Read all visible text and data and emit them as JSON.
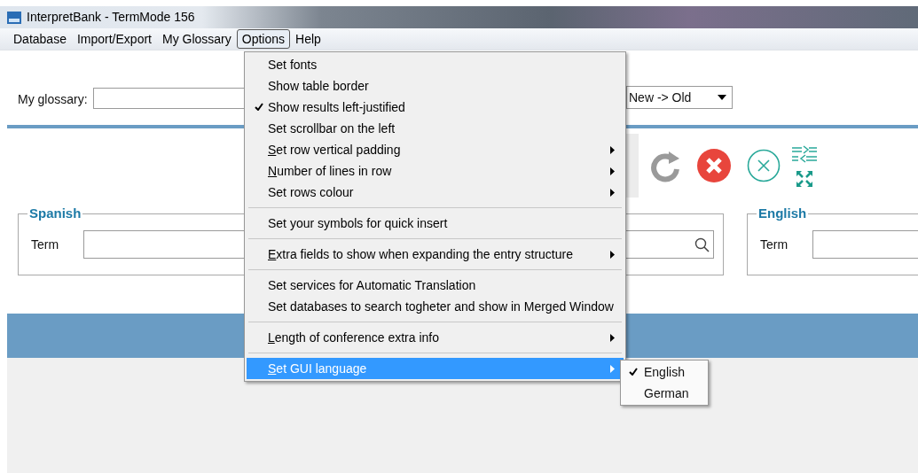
{
  "window": {
    "title": "InterpretBank - TermMode 156"
  },
  "menu_bar": [
    {
      "label": "Database",
      "selected": false
    },
    {
      "label": "Import/Export",
      "selected": false
    },
    {
      "label": "My Glossary",
      "selected": false
    },
    {
      "label": "Options",
      "selected": true
    },
    {
      "label": "Help",
      "selected": false
    }
  ],
  "glossary": {
    "label": "My glossary:",
    "sort": "New -> Old"
  },
  "language_panels": [
    {
      "language": "Spanish",
      "term_label": "Term"
    },
    {
      "language": "English",
      "term_label": "Term"
    }
  ],
  "options_menu": [
    [
      {
        "label": "Set fonts",
        "checked": false,
        "submenu": false,
        "mnemonic": false,
        "highlighted": false
      },
      {
        "label": "Show table border",
        "checked": false,
        "submenu": false,
        "mnemonic": false,
        "highlighted": false
      },
      {
        "label": "Show results left-justified",
        "checked": true,
        "submenu": false,
        "mnemonic": false,
        "highlighted": false
      },
      {
        "label": "Set scrollbar on the left",
        "checked": false,
        "submenu": false,
        "mnemonic": false,
        "highlighted": false
      },
      {
        "label": "Set row vertical padding",
        "checked": false,
        "submenu": true,
        "mnemonic": true,
        "highlighted": false
      },
      {
        "label": "Number of lines in row",
        "checked": false,
        "submenu": true,
        "mnemonic": true,
        "highlighted": false
      },
      {
        "label": "Set rows colour",
        "checked": false,
        "submenu": true,
        "mnemonic": false,
        "highlighted": false
      }
    ],
    [
      {
        "label": "Set your symbols for quick insert",
        "checked": false,
        "submenu": false,
        "mnemonic": false,
        "highlighted": false
      }
    ],
    [
      {
        "label": "Extra fields to show when expanding the entry structure",
        "checked": false,
        "submenu": true,
        "mnemonic": true,
        "highlighted": false
      }
    ],
    [
      {
        "label": "Set services for Automatic Translation",
        "checked": false,
        "submenu": false,
        "mnemonic": false,
        "highlighted": false
      },
      {
        "label": "Set databases to search togheter and show in Merged Window",
        "checked": false,
        "submenu": false,
        "mnemonic": false,
        "highlighted": false
      }
    ],
    [
      {
        "label": "Length of conference extra info",
        "checked": false,
        "submenu": true,
        "mnemonic": true,
        "highlighted": false
      }
    ],
    [
      {
        "label": "Set GUI language",
        "checked": false,
        "submenu": true,
        "mnemonic": true,
        "highlighted": true
      }
    ]
  ],
  "language_submenu": [
    {
      "label": "English",
      "checked": true
    },
    {
      "label": "German",
      "checked": false
    }
  ]
}
